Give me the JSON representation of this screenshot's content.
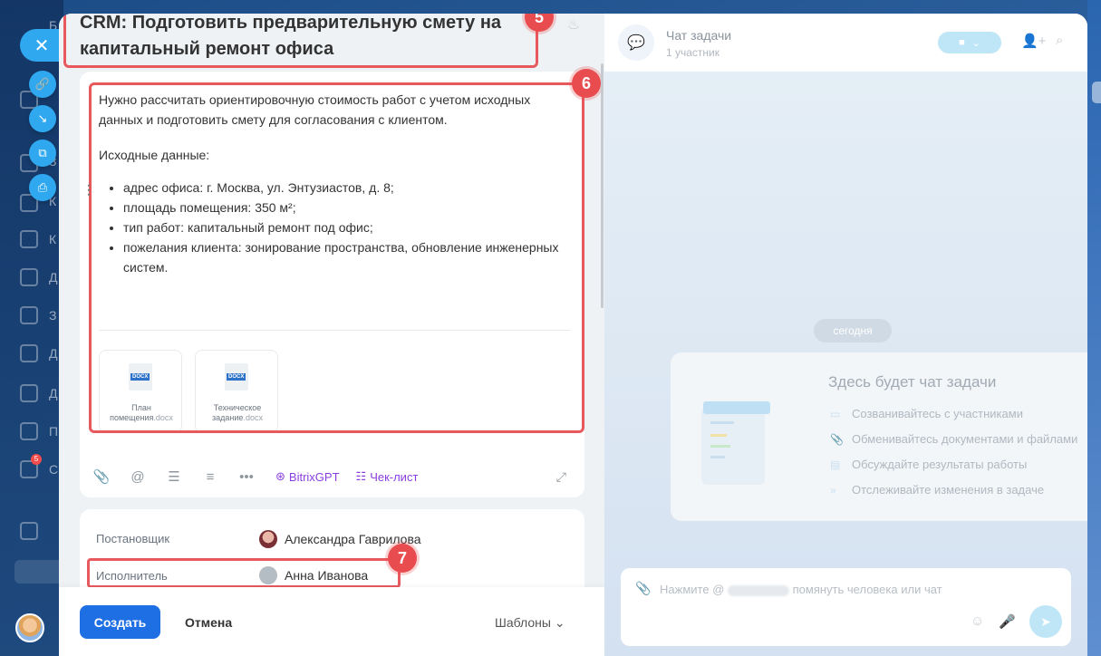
{
  "task": {
    "title": "CRM: Подготовить предварительную смету на капитальный ремонт офиса",
    "description_intro": "Нужно рассчитать ориентировочную стоимость работ с учетом исходных данных и подготовить смету для согласования с клиентом.",
    "description_source_label": "Исходные данные:",
    "description_items": [
      "адрес офиса: г. Москва, ул. Энтузиастов, д. 8;",
      "площадь помещения: 350 м²;",
      "тип работ: капитальный ремонт под офис;",
      "пожелания клиента: зонирование пространства, обновление инженерных систем."
    ],
    "files": [
      {
        "name": "План помещения",
        "ext": ".docx",
        "badge": "DOCX"
      },
      {
        "name": "Техническое задание",
        "ext": ".docx",
        "badge": "DOCX"
      }
    ]
  },
  "badges": {
    "title": "5",
    "description": "6",
    "assignee": "7"
  },
  "toolbar": {
    "icons": [
      "paperclip-icon",
      "mention-icon",
      "bullet-list-icon",
      "numbered-list-icon",
      "more-icon"
    ],
    "gpt_label": "BitrixGPT",
    "checklist_label": "Чек-лист"
  },
  "people": {
    "creator_label": "Постановщик",
    "creator_name": "Александра Гаврилова",
    "assignee_label": "Исполнитель",
    "assignee_name": "Анна Иванова"
  },
  "footer": {
    "create_label": "Создать",
    "cancel_label": "Отмена",
    "templates_label": "Шаблоны"
  },
  "chat": {
    "title": "Чат задачи",
    "subtitle": "1 участник",
    "date_label": "сегодня",
    "empty_title": "Здесь будет чат задачи",
    "empty_items": [
      "Созванивайтесь с участниками",
      "Обменивайтесь документами и файлами",
      "Обсуждайте результаты работы",
      "Отслеживайте изменения в задаче"
    ],
    "composer_placeholder_start": "Нажмите @",
    "composer_placeholder_end": "помянуть человека или чат"
  },
  "sidebar": {
    "letters": [
      "Б",
      "З",
      "К",
      "К",
      "Д",
      "З",
      "Д",
      "Д",
      "П",
      "С"
    ],
    "counter": "5"
  },
  "colors": {
    "accent": "#1e6fe3",
    "highlight": "#e8595e",
    "gpt": "#8b3ee0"
  }
}
